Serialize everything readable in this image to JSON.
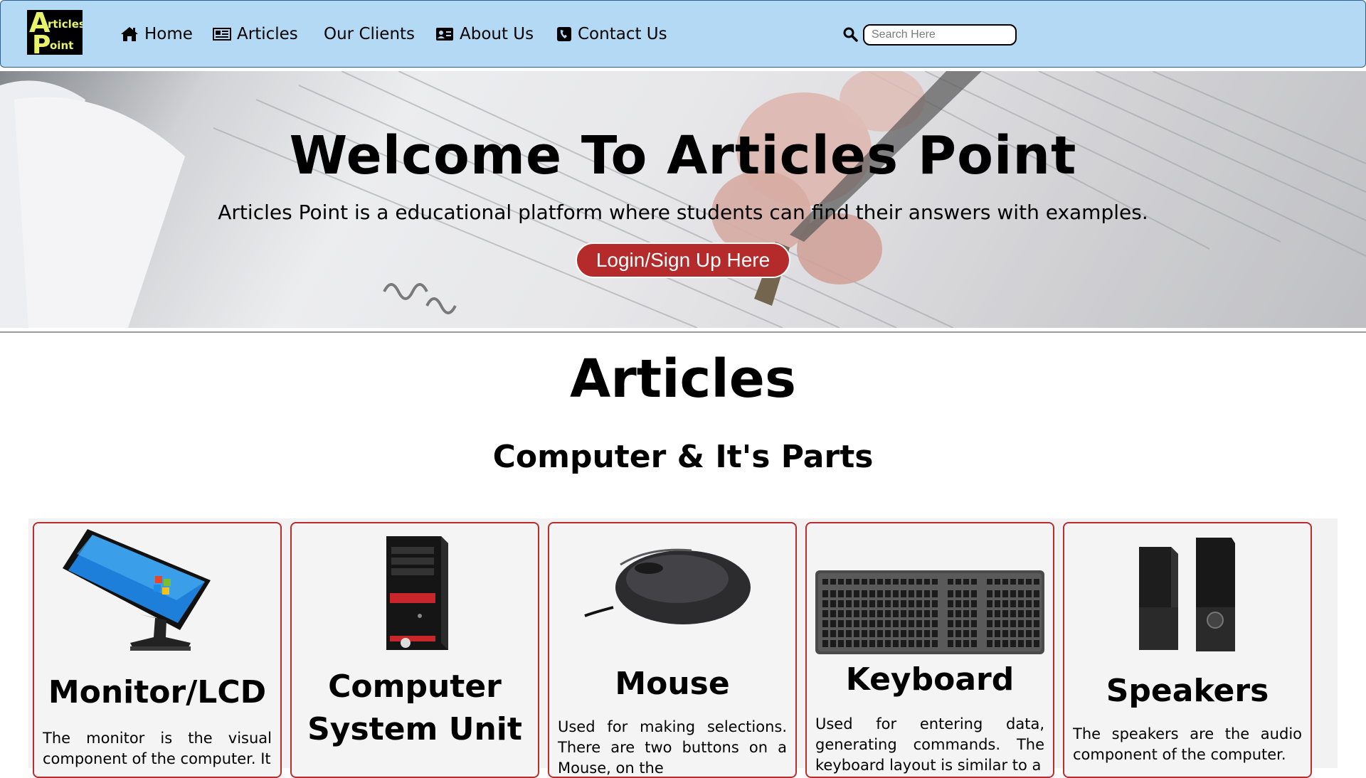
{
  "nav": {
    "logo_letter_a": "A",
    "logo_rest_a": "rticles",
    "logo_letter_p": "P",
    "logo_rest_p": "oint",
    "items": [
      {
        "label": "Home",
        "icon": "home-icon"
      },
      {
        "label": "Articles",
        "icon": "newspaper-icon"
      },
      {
        "label": "Our Clients",
        "icon": ""
      },
      {
        "label": "About Us",
        "icon": "id-card-icon"
      },
      {
        "label": "Contact Us",
        "icon": "phone-icon"
      }
    ],
    "search_placeholder": "Search Here"
  },
  "hero": {
    "title": "Welcome To Articles Point",
    "subtitle": "Articles Point is a educational platform where students can find their answers with examples.",
    "button": "Login/Sign Up Here"
  },
  "articles": {
    "title": "Articles",
    "subtitle": "Computer & It's Parts",
    "cards": [
      {
        "title": "Monitor/LCD",
        "text": "The monitor is the visual component of the computer. It",
        "image": "monitor-image"
      },
      {
        "title": "Computer System Unit",
        "text": "",
        "image": "cpu-image"
      },
      {
        "title": "Mouse",
        "text": "Used for making selections. There are two buttons on a Mouse, on the",
        "image": "mouse-image"
      },
      {
        "title": "Keyboard",
        "text": "Used for entering data, generating commands. The keyboard layout is similar to a",
        "image": "keyboard-image"
      },
      {
        "title": "Speakers",
        "text": "The speakers are the audio component of the computer.",
        "image": "speakers-image"
      }
    ]
  },
  "colors": {
    "navbar_bg": "#b3d9f5",
    "button_bg": "#b52b2b",
    "card_border": "#b82e2e"
  }
}
